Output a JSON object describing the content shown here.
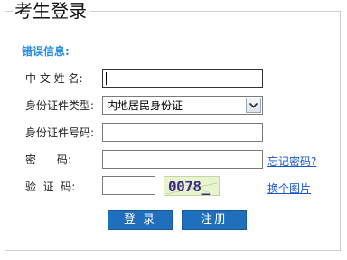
{
  "panel": {
    "title": "考生登录",
    "error_label": "错误信息:"
  },
  "form": {
    "name_label": "中 文 姓 名:",
    "name_value": "",
    "id_type_label": "身份证件类型:",
    "id_type_value": "内地居民身份证",
    "id_number_label": "身份证件号码:",
    "id_number_value": "",
    "password_label": "密      码:",
    "password_value": "",
    "captcha_label": "验  证  码:",
    "captcha_value": "",
    "captcha_image_text": "0078_"
  },
  "links": {
    "forgot_password": "忘记密码?",
    "change_image": "换个图片"
  },
  "buttons": {
    "login": "登 录",
    "register": "注册"
  },
  "colors": {
    "accent": "#2a8ee0",
    "button": "#1f6fbd",
    "link": "#1a57c8"
  }
}
